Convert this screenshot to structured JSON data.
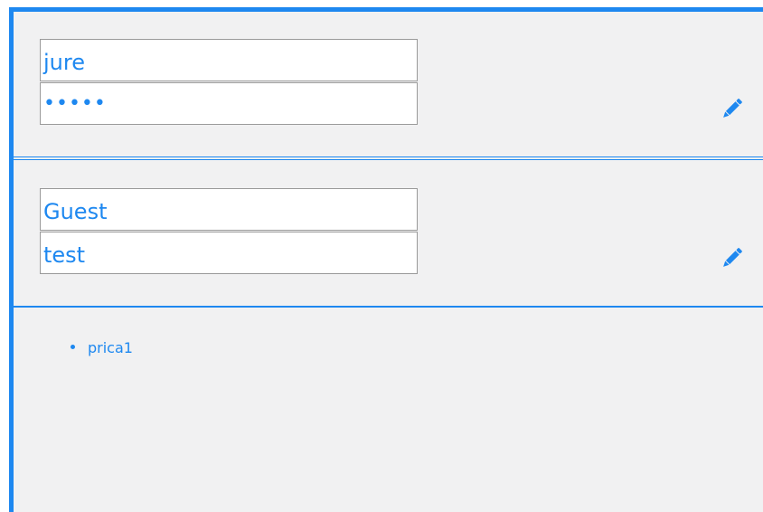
{
  "accounts": [
    {
      "username": "jure",
      "password_masked": "•••••",
      "edit_icon": "pencil-icon"
    },
    {
      "username": "Guest",
      "password": "test",
      "edit_icon": "pencil-icon"
    }
  ],
  "list": {
    "items": [
      "prica1"
    ]
  },
  "colors": {
    "accent": "#1e88f0",
    "panel_bg": "#f1f1f2",
    "field_border": "#9a9a9a"
  }
}
